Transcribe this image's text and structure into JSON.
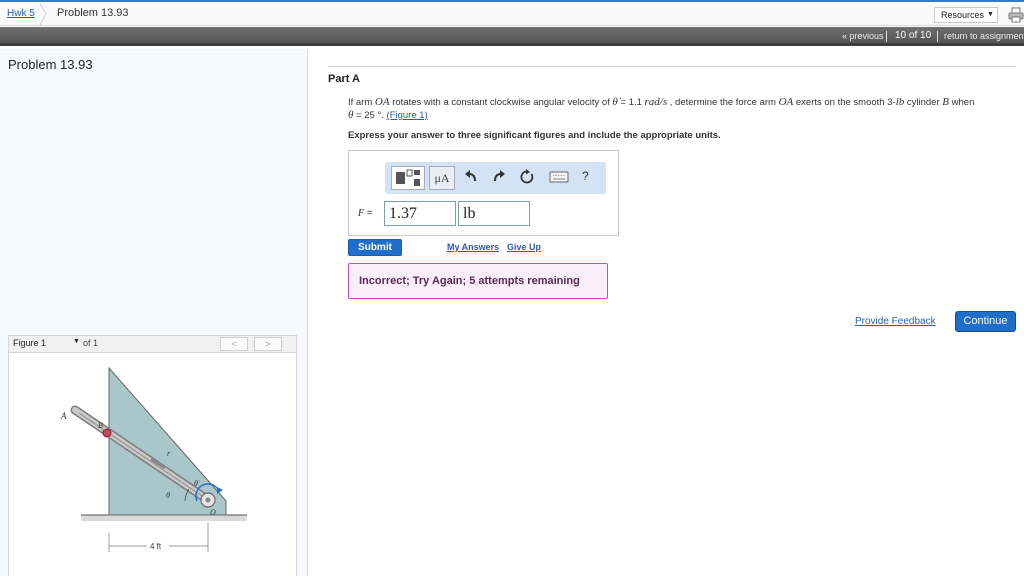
{
  "breadcrumb": {
    "assignment": "Hwk 5",
    "problem": "Problem 13.93"
  },
  "header": {
    "resources_label": "Resources"
  },
  "nav": {
    "previous": "« previous",
    "count": "10 of 10",
    "return": "return to assignment"
  },
  "left": {
    "title": "Problem 13.93",
    "figure": {
      "selected": "Figure 1",
      "of": "of 1",
      "prev": "<",
      "next": ">",
      "labels": {
        "A": "A",
        "B": "B",
        "O": "O",
        "theta": "θ",
        "thetadot": "θ̇",
        "r": "r",
        "width": "4 ft"
      }
    }
  },
  "part": {
    "title": "Part A",
    "question": {
      "p1": "If arm ",
      "oa1": "OA",
      "p2": " rotates with a constant clockwise angular velocity of ",
      "thetadot": "θ̇",
      "p3": " = 1.1 ",
      "rad": "rad/s",
      "p4": " , determine the force arm ",
      "oa2": "OA",
      "p5": " exerts on the smooth 3-",
      "lb": "lb",
      "p6": " cylinder ",
      "b": "B",
      "p7": " when",
      "theta": "θ",
      "p8": " = 25 °. ",
      "figure_link": "(Figure 1)"
    },
    "instruction": "Express your answer to three significant figures and include the appropriate units.",
    "toolbar": {
      "mu": "μA",
      "help": "?"
    },
    "answer": {
      "var": "F",
      "eq": " =",
      "value": "1.37",
      "unit": "lb"
    },
    "submit": "Submit",
    "my_answers": "My Answers",
    "give_up": "Give Up",
    "feedback": "Incorrect; Try Again; 5 attempts remaining"
  },
  "footer": {
    "provide_feedback": "Provide Feedback",
    "continue": "Continue"
  },
  "colors": {
    "accent": "#1f6ec9",
    "error_border": "#c04fb6",
    "figure_fill": "#a9c7c9"
  }
}
